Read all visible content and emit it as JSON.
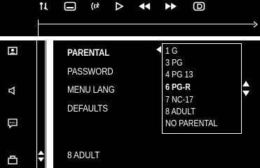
{
  "toolbar": {
    "icons": [
      "language-audio-icon",
      "subtitle-icon",
      "angle-icon",
      "play-icon",
      "rewind-icon",
      "fast-forward-icon",
      "display-icon"
    ]
  },
  "sidebar": {
    "icons": [
      "picture-icon",
      "audio-icon",
      "subtitle-menu-icon",
      "parental-lock-icon"
    ]
  },
  "menu": {
    "items": [
      "PARENTAL",
      "PASSWORD",
      "MENU LANG",
      "DEFAULTS"
    ],
    "active_index": 0
  },
  "dropdown": {
    "options": [
      "1 G",
      "3 PG",
      "4 PG 13",
      "6 PG-R",
      "7 NC-17",
      "8 ADULT",
      "NO PARENTAL"
    ],
    "selected_index": 3
  },
  "current_value": "8 ADULT"
}
